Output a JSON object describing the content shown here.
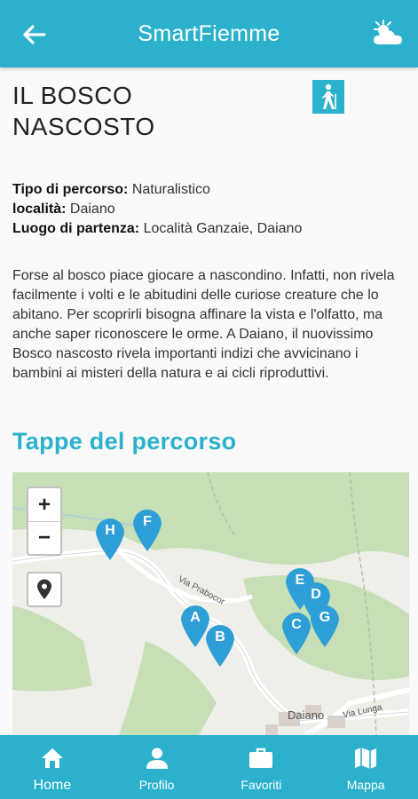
{
  "header": {
    "title": "SmartFiemme",
    "back_icon": "arrow-left-icon",
    "weather_icon": "partly-cloudy-icon"
  },
  "route": {
    "title": "IL BOSCO NASCOSTO",
    "activity_icon": "hiker-icon",
    "info": [
      {
        "label": "Tipo di percorso:",
        "value": "Naturalistico"
      },
      {
        "label": "località:",
        "value": "Daiano"
      },
      {
        "label": "Luogo di partenza:",
        "value": "Località Ganzaie, Daiano"
      }
    ],
    "description": "Forse al bosco piace giocare a nascondino. Infatti, non rivela facilmente i volti e le abitudini delle curiose creature che lo abitano. Per scoprirli bisogna affinare la vista e l'olfatto, ma anche saper riconoscere le orme. A Daiano, il nuovissimo Bosco nascosto rivela importanti indizi che avvicinano i bambini ai misteri della natura e ai cicli riproduttivi."
  },
  "stages": {
    "title": "Tappe del percorso",
    "map": {
      "zoom_in": "+",
      "zoom_out": "−",
      "locate_icon": "location-pin-icon",
      "street_prabocor": "Via Prabocor",
      "street_lunga": "Via Lunga",
      "town": "Daiano",
      "markers": [
        "A",
        "B",
        "C",
        "D",
        "E",
        "F",
        "G",
        "H"
      ],
      "marker_color": "#2e9fd6"
    }
  },
  "bottom_nav": [
    {
      "label": "Home",
      "icon": "home-icon"
    },
    {
      "label": "Profilo",
      "icon": "person-icon"
    },
    {
      "label": "Favoriti",
      "icon": "briefcase-icon"
    },
    {
      "label": "Mappa",
      "icon": "map-icon"
    }
  ],
  "colors": {
    "primary": "#2bb1cc",
    "forest": "#c6dfb6",
    "marker": "#2e9fd6"
  }
}
